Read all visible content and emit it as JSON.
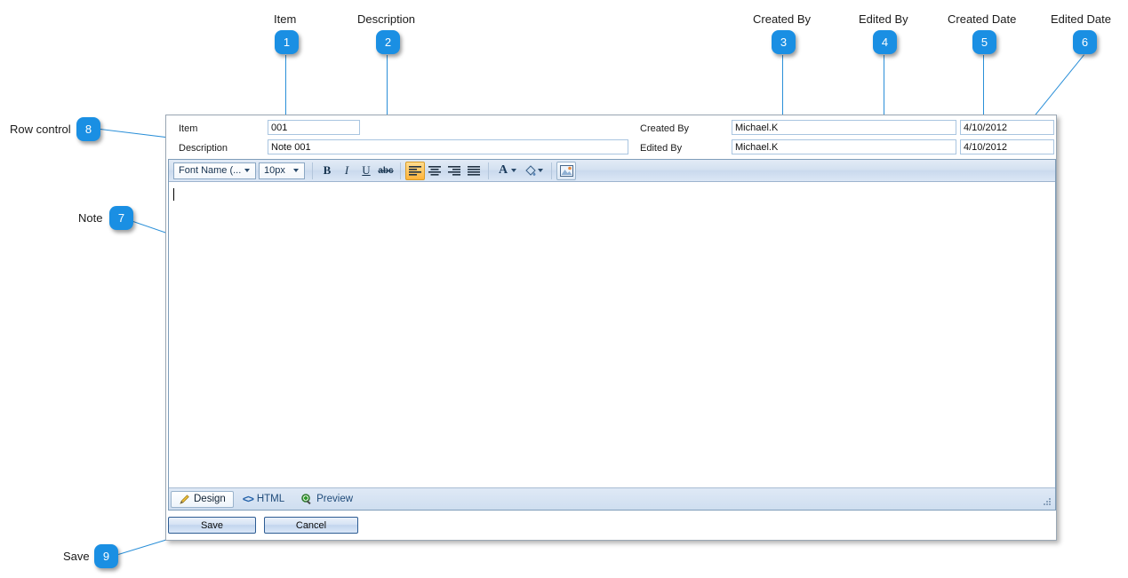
{
  "callouts": [
    {
      "n": "1",
      "label": "Item"
    },
    {
      "n": "2",
      "label": "Description"
    },
    {
      "n": "3",
      "label": "Created By"
    },
    {
      "n": "4",
      "label": "Edited By"
    },
    {
      "n": "5",
      "label": "Created Date"
    },
    {
      "n": "6",
      "label": "Edited Date"
    },
    {
      "n": "7",
      "label": "Note"
    },
    {
      "n": "8",
      "label": "Row control"
    },
    {
      "n": "9",
      "label": "Save"
    }
  ],
  "form": {
    "item": {
      "label": "Item",
      "value": "001"
    },
    "description": {
      "label": "Description",
      "value": "Note 001"
    },
    "created_by": {
      "label": "Created By",
      "value": "Michael.K"
    },
    "edited_by": {
      "label": "Edited By",
      "value": "Michael.K"
    },
    "created_date": {
      "label": "",
      "value": "4/10/2012"
    },
    "edited_date": {
      "label": "",
      "value": "4/10/2012"
    }
  },
  "editor": {
    "toolbar": {
      "font_name": "Font Name (...",
      "font_size": "10px",
      "bold": "B",
      "italic": "I",
      "underline": "U",
      "strikethrough": "abc",
      "align_left": "align-left-icon",
      "align_center": "align-center-icon",
      "align_right": "align-right-icon",
      "align_justify": "align-justify-icon",
      "font_color": "A",
      "highlight_color": "fill-icon",
      "insert_image": "image-icon"
    },
    "body_text": "",
    "tabs": [
      {
        "label": "Design",
        "icon": "pencil-icon",
        "active": true
      },
      {
        "label": "HTML",
        "icon": "code-icon",
        "active": false
      },
      {
        "label": "Preview",
        "icon": "magnifier-icon",
        "active": false
      }
    ]
  },
  "buttons": {
    "save": "Save",
    "cancel": "Cancel"
  },
  "colors": {
    "badge": "#1a8fe3",
    "leader": "#2a8fd8",
    "toolbar_active": "#ffb43c",
    "field_border": "#a9c5e0"
  }
}
